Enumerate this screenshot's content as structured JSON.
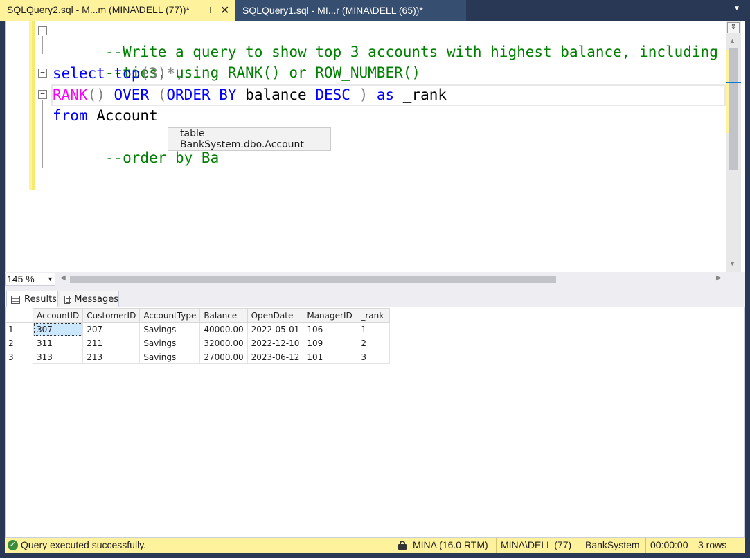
{
  "tabs": [
    {
      "label": "SQLQuery2.sql - M...m (MINA\\DELL (77))*",
      "active": true
    },
    {
      "label": "SQLQuery1.sql - MI...r (MINA\\DELL (65))*",
      "active": false
    }
  ],
  "icons": {
    "pin": "pin-icon",
    "close": "close-icon",
    "tab_dropdown": "chevron-down-icon",
    "results": "grid-icon",
    "messages": "messages-icon",
    "status_ok": "check-circle-icon",
    "lock": "lock-icon"
  },
  "editor": {
    "line1_comment": "--Write a query to show top 3 accounts with highest balance, including",
    "line2_comment": "--ties, using RANK() or ROW_NUMBER()",
    "line3_kw1": "select",
    "line3_kw2": "top",
    "line3_rest": "(3)*,",
    "line4_fn": "RANK",
    "line4_p1": "() ",
    "line4_over": "OVER",
    "line4_p2": " (",
    "line4_order": "ORDER BY",
    "line4_col": " balance ",
    "line4_desc": "DESC",
    "line4_p3": " ) ",
    "line4_as": "as",
    "line4_alias": " _rank",
    "line5_kw": "from",
    "line5_table": " Account",
    "line6_comment": "--order by Ba",
    "tooltip": "table BankSystem.dbo.Account"
  },
  "zoom": {
    "value": "145 %"
  },
  "results_tabs": {
    "results": "Results",
    "messages": "Messages"
  },
  "grid": {
    "columns": [
      "AccountID",
      "CustomerID",
      "AccountType",
      "Balance",
      "OpenDate",
      "ManagerID",
      "_rank"
    ],
    "rows": [
      {
        "n": "1",
        "cells": [
          "307",
          "207",
          "Savings",
          "40000.00",
          "2022-05-01",
          "106",
          "1"
        ]
      },
      {
        "n": "2",
        "cells": [
          "311",
          "211",
          "Savings",
          "32000.00",
          "2022-12-10",
          "109",
          "2"
        ]
      },
      {
        "n": "3",
        "cells": [
          "313",
          "213",
          "Savings",
          "27000.00",
          "2023-06-12",
          "101",
          "3"
        ]
      }
    ]
  },
  "status": {
    "message": "Query executed successfully.",
    "server": "MINA (16.0 RTM)",
    "user": "MINA\\DELL (77)",
    "database": "BankSystem",
    "elapsed": "00:00:00",
    "rows": "3 rows"
  },
  "colors": {
    "accent_yellow": "#fff29d",
    "frame": "#293955",
    "keyword": "#0000ff",
    "comment": "#008000",
    "function": "#ff00ff"
  }
}
